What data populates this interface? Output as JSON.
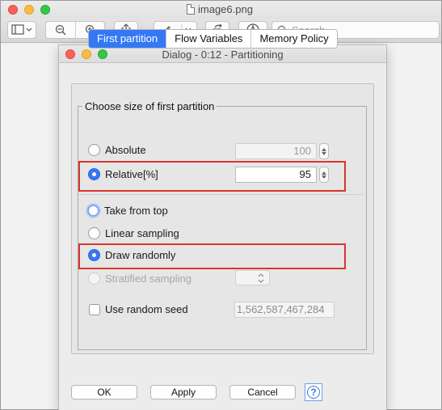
{
  "window": {
    "title": "image6.png"
  },
  "toolbar": {
    "search_placeholder": "Search",
    "icons": [
      "sidebar-icon",
      "zoom-out-icon",
      "zoom-in-icon",
      "share-icon",
      "markup-pen-icon",
      "rotate-icon",
      "annotate-icon",
      "search-icon"
    ]
  },
  "dialog": {
    "title": "Dialog - 0:12 - Partitioning",
    "tabs": [
      {
        "label": "First partition",
        "active": true
      },
      {
        "label": "Flow Variables",
        "active": false
      },
      {
        "label": "Memory Policy",
        "active": false
      }
    ],
    "group_title": "Choose size of first partition",
    "size_options": {
      "absolute_label": "Absolute",
      "absolute_value": "100",
      "relative_label": "Relative[%]",
      "relative_value": "95",
      "selected": "relative"
    },
    "sampling_options": [
      {
        "label": "Take from top",
        "state": "focused"
      },
      {
        "label": "Linear sampling",
        "state": "normal"
      },
      {
        "label": "Draw randomly",
        "state": "checked"
      },
      {
        "label": "Stratified sampling",
        "state": "disabled"
      }
    ],
    "seed": {
      "label": "Use random seed",
      "checked": false,
      "value": "1,562,587,467,284"
    },
    "buttons": {
      "ok": "OK",
      "apply": "Apply",
      "cancel": "Cancel",
      "help": "?"
    }
  },
  "colors": {
    "accent": "#3478f6",
    "highlight": "#d9362b"
  }
}
